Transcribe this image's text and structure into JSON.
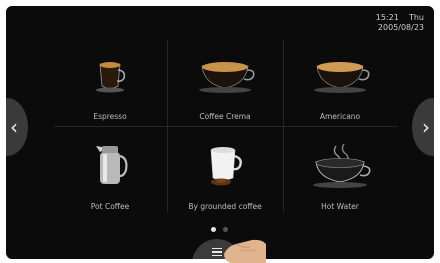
{
  "clock": {
    "time": "15:21",
    "day": "Thu",
    "date": "2005/08/23"
  },
  "tiles": [
    {
      "label": "Espresso"
    },
    {
      "label": "Coffee Crema"
    },
    {
      "label": "Americano"
    },
    {
      "label": "Pot Coffee"
    },
    {
      "label": "By grounded coffee"
    },
    {
      "label": "Hot Water"
    }
  ],
  "nav": {
    "prev_glyph": "‹",
    "next_glyph": "›"
  },
  "pager": {
    "page": 1,
    "count": 2
  },
  "icons": {
    "menu": "menu-icon",
    "prev": "chevron-left-icon",
    "next": "chevron-right-icon"
  }
}
